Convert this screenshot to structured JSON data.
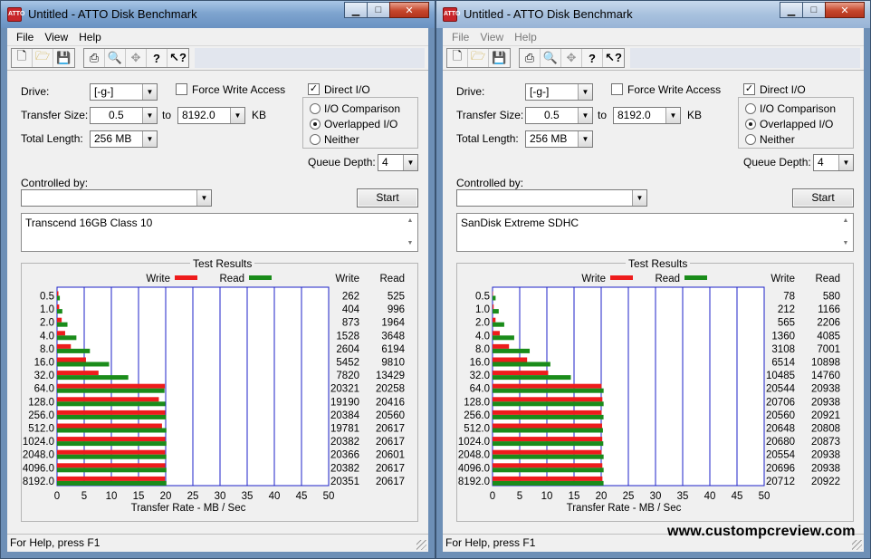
{
  "watermark": "www.custompcreview.com",
  "colors": {
    "write": "#ee1c1c",
    "read": "#1a8c1a",
    "grid": "#1c22c8"
  },
  "windows": [
    {
      "title": "Untitled - ATTO Disk Benchmark",
      "menu": [
        "File",
        "View",
        "Help"
      ],
      "toolbar_icons": [
        "new-icon",
        "open-icon",
        "save-icon",
        "print-icon",
        "print-preview-icon",
        "move-icon",
        "help-icon",
        "context-help-icon"
      ],
      "drive_label": "Drive:",
      "drive_value": "[-g-]",
      "transfer_size_label": "Transfer Size:",
      "transfer_from": "0.5",
      "to_label": "to",
      "transfer_to": "8192.0",
      "kb_label": "KB",
      "total_length_label": "Total Length:",
      "total_length_value": "256 MB",
      "force_write_label": "Force Write Access",
      "force_write_checked": false,
      "direct_io_label": "Direct I/O",
      "direct_io_checked": true,
      "io_comparison_label": "I/O Comparison",
      "overlapped_io_label": "Overlapped I/O",
      "neither_label": "Neither",
      "io_mode_selected": "overlapped",
      "queue_depth_label": "Queue Depth:",
      "queue_depth_value": "4",
      "controlled_by_label": "Controlled by:",
      "controlled_by_value": "",
      "start_label": "Start",
      "description": "Transcend 16GB Class 10",
      "status": "For Help, press F1",
      "chart_data": {
        "type": "bar",
        "title": "Test Results",
        "legend": [
          "Write",
          "Read"
        ],
        "xlabel": "Transfer Rate - MB / Sec",
        "xlim": [
          0,
          50
        ],
        "xticks": [
          "0",
          "5",
          "10",
          "15",
          "20",
          "25",
          "30",
          "35",
          "40",
          "45",
          "50"
        ],
        "col_write": "Write",
        "col_read": "Read",
        "categories": [
          "0.5",
          "1.0",
          "2.0",
          "4.0",
          "8.0",
          "16.0",
          "32.0",
          "64.0",
          "128.0",
          "256.0",
          "512.0",
          "1024.0",
          "2048.0",
          "4096.0",
          "8192.0"
        ],
        "series": [
          {
            "name": "Write",
            "values": [
              262,
              404,
              873,
              1528,
              2604,
              5452,
              7820,
              20321,
              19190,
              20384,
              19781,
              20382,
              20366,
              20382,
              20351
            ]
          },
          {
            "name": "Read",
            "values": [
              525,
              996,
              1964,
              3648,
              6194,
              9810,
              13429,
              20258,
              20416,
              20560,
              20617,
              20617,
              20601,
              20617,
              20617
            ]
          }
        ]
      }
    },
    {
      "title": "Untitled - ATTO Disk Benchmark",
      "menu": [
        "File",
        "View",
        "Help"
      ],
      "toolbar_icons": [
        "new-icon",
        "open-icon",
        "save-icon",
        "print-icon",
        "print-preview-icon",
        "move-icon",
        "help-icon",
        "context-help-icon"
      ],
      "drive_label": "Drive:",
      "drive_value": "[-g-]",
      "transfer_size_label": "Transfer Size:",
      "transfer_from": "0.5",
      "to_label": "to",
      "transfer_to": "8192.0",
      "kb_label": "KB",
      "total_length_label": "Total Length:",
      "total_length_value": "256 MB",
      "force_write_label": "Force Write Access",
      "force_write_checked": false,
      "direct_io_label": "Direct I/O",
      "direct_io_checked": true,
      "io_comparison_label": "I/O Comparison",
      "overlapped_io_label": "Overlapped I/O",
      "neither_label": "Neither",
      "io_mode_selected": "overlapped",
      "queue_depth_label": "Queue Depth:",
      "queue_depth_value": "4",
      "controlled_by_label": "Controlled by:",
      "controlled_by_value": "",
      "start_label": "Start",
      "description": "SanDisk Extreme SDHC",
      "status": "For Help, press F1",
      "chart_data": {
        "type": "bar",
        "title": "Test Results",
        "legend": [
          "Write",
          "Read"
        ],
        "xlabel": "Transfer Rate - MB / Sec",
        "xlim": [
          0,
          50
        ],
        "xticks": [
          "0",
          "5",
          "10",
          "15",
          "20",
          "25",
          "30",
          "35",
          "40",
          "45",
          "50"
        ],
        "col_write": "Write",
        "col_read": "Read",
        "categories": [
          "0.5",
          "1.0",
          "2.0",
          "4.0",
          "8.0",
          "16.0",
          "32.0",
          "64.0",
          "128.0",
          "256.0",
          "512.0",
          "1024.0",
          "2048.0",
          "4096.0",
          "8192.0"
        ],
        "series": [
          {
            "name": "Write",
            "values": [
              78,
              212,
              565,
              1360,
              3108,
              6514,
              10485,
              20544,
              20706,
              20560,
              20648,
              20680,
              20554,
              20696,
              20712
            ]
          },
          {
            "name": "Read",
            "values": [
              580,
              1166,
              2206,
              4085,
              7001,
              10898,
              14760,
              20938,
              20938,
              20921,
              20808,
              20873,
              20938,
              20938,
              20922
            ]
          }
        ]
      }
    }
  ]
}
